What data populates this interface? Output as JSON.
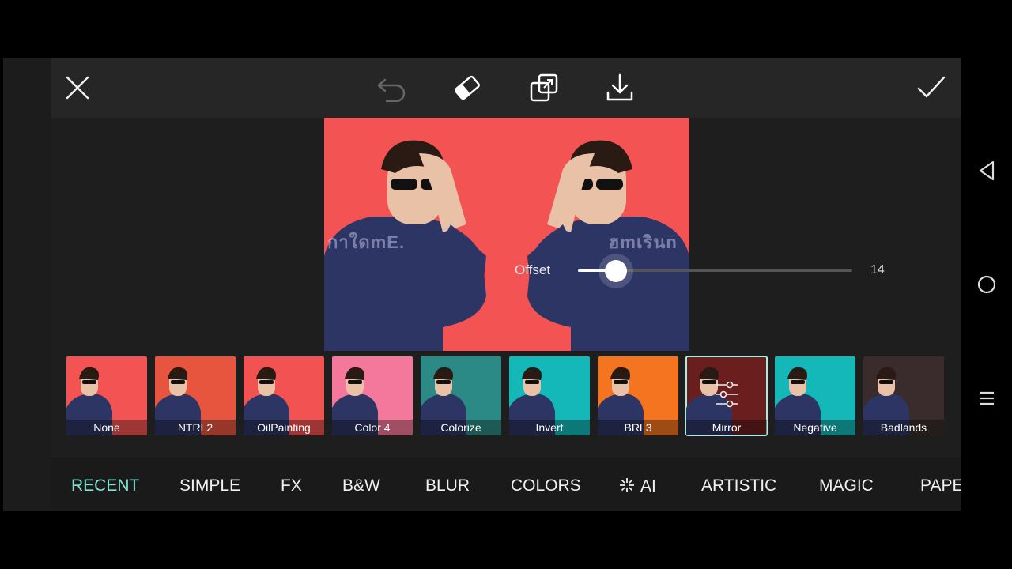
{
  "toolbar": {
    "close_icon": "close-icon",
    "undo_icon": "undo-icon",
    "eraser_icon": "eraser-icon",
    "compare_icon": "compare-icon",
    "download_icon": "download-icon",
    "apply_icon": "check-icon"
  },
  "canvas": {
    "background": "#f35353",
    "watermark_left": "กาใดmE.",
    "watermark_right": "ฮmเรินn"
  },
  "slider": {
    "label": "Offset",
    "value": "14",
    "fraction": 0.14
  },
  "effects": [
    {
      "label": "None",
      "bg": "#f35353"
    },
    {
      "label": "NTRL2",
      "bg": "#e8553f"
    },
    {
      "label": "OilPainting",
      "bg": "#f25252"
    },
    {
      "label": "Color 4",
      "bg": "#f4789b"
    },
    {
      "label": "Colorize",
      "bg": "#2b8a85"
    },
    {
      "label": "Invert",
      "bg": "#14b8b8"
    },
    {
      "label": "BRL3",
      "bg": "#f5741f"
    },
    {
      "label": "Mirror",
      "bg": "#6a1e1e",
      "selected": true
    },
    {
      "label": "Negative",
      "bg": "#14b8b8"
    },
    {
      "label": "Badlands",
      "bg": "#3a2c2c"
    }
  ],
  "categories": [
    {
      "label": "RECENT",
      "active": true
    },
    {
      "label": "SIMPLE"
    },
    {
      "label": "FX"
    },
    {
      "label": "B&W"
    },
    {
      "label": "BLUR"
    },
    {
      "label": "COLORS"
    },
    {
      "label": "AI"
    },
    {
      "label": "ARTISTIC"
    },
    {
      "label": "MAGIC"
    },
    {
      "label": "PAPE"
    }
  ],
  "system_nav": {
    "back_icon": "back-triangle-icon",
    "home_icon": "home-circle-icon",
    "menu_icon": "menu-icon"
  },
  "colors": {
    "accent": "#7fe3cf",
    "selected_outline": "#9ef0e2"
  }
}
